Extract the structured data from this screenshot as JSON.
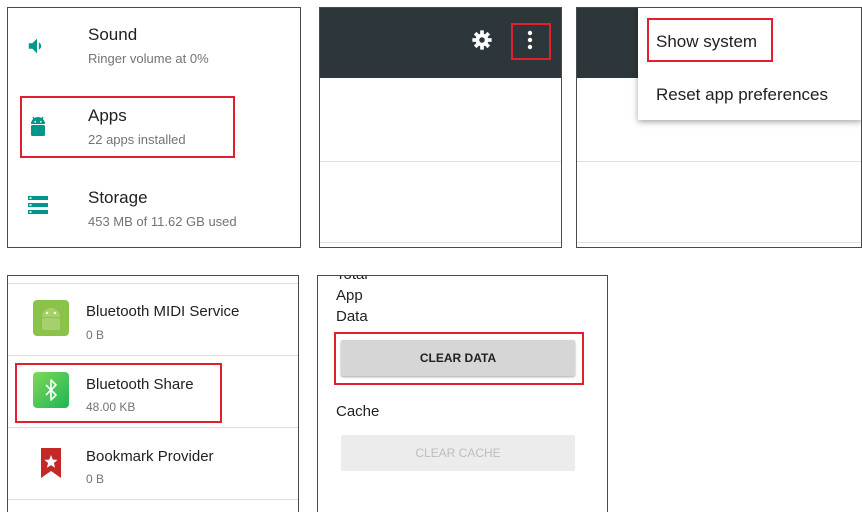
{
  "settings_list": {
    "items": [
      {
        "title": "Sound",
        "subtitle": "Ringer volume at 0%",
        "icon": "volume-icon"
      },
      {
        "title": "Apps",
        "subtitle": "22 apps installed",
        "icon": "android-icon"
      },
      {
        "title": "Storage",
        "subtitle": "453 MB of 11.62 GB used",
        "icon": "storage-icon"
      }
    ]
  },
  "toolbar": {
    "icons": [
      "gear-icon",
      "more-vert-icon"
    ]
  },
  "overflow_menu": {
    "items": [
      "Show system",
      "Reset app preferences"
    ]
  },
  "app_list": {
    "items": [
      {
        "name": "Bluetooth MIDI Service",
        "size": "0 B",
        "icon": "android-app-icon"
      },
      {
        "name": "Bluetooth Share",
        "size": "48.00 KB",
        "icon": "bluetooth-icon"
      },
      {
        "name": "Bookmark Provider",
        "size": "0 B",
        "icon": "bookmark-icon"
      }
    ]
  },
  "storage_detail": {
    "cut_label": "Total",
    "data_label_line1": "App",
    "data_label_line2": "Data",
    "clear_data_button": "CLEAR DATA",
    "cache_label": "Cache",
    "clear_cache_button": "CLEAR CACHE"
  },
  "colors": {
    "accent_teal": "#009688",
    "toolbar_dark": "#2d363a",
    "highlight_red": "#e0202c",
    "bluetooth_green": "#3ec15a",
    "bookmark_red": "#c62828"
  }
}
